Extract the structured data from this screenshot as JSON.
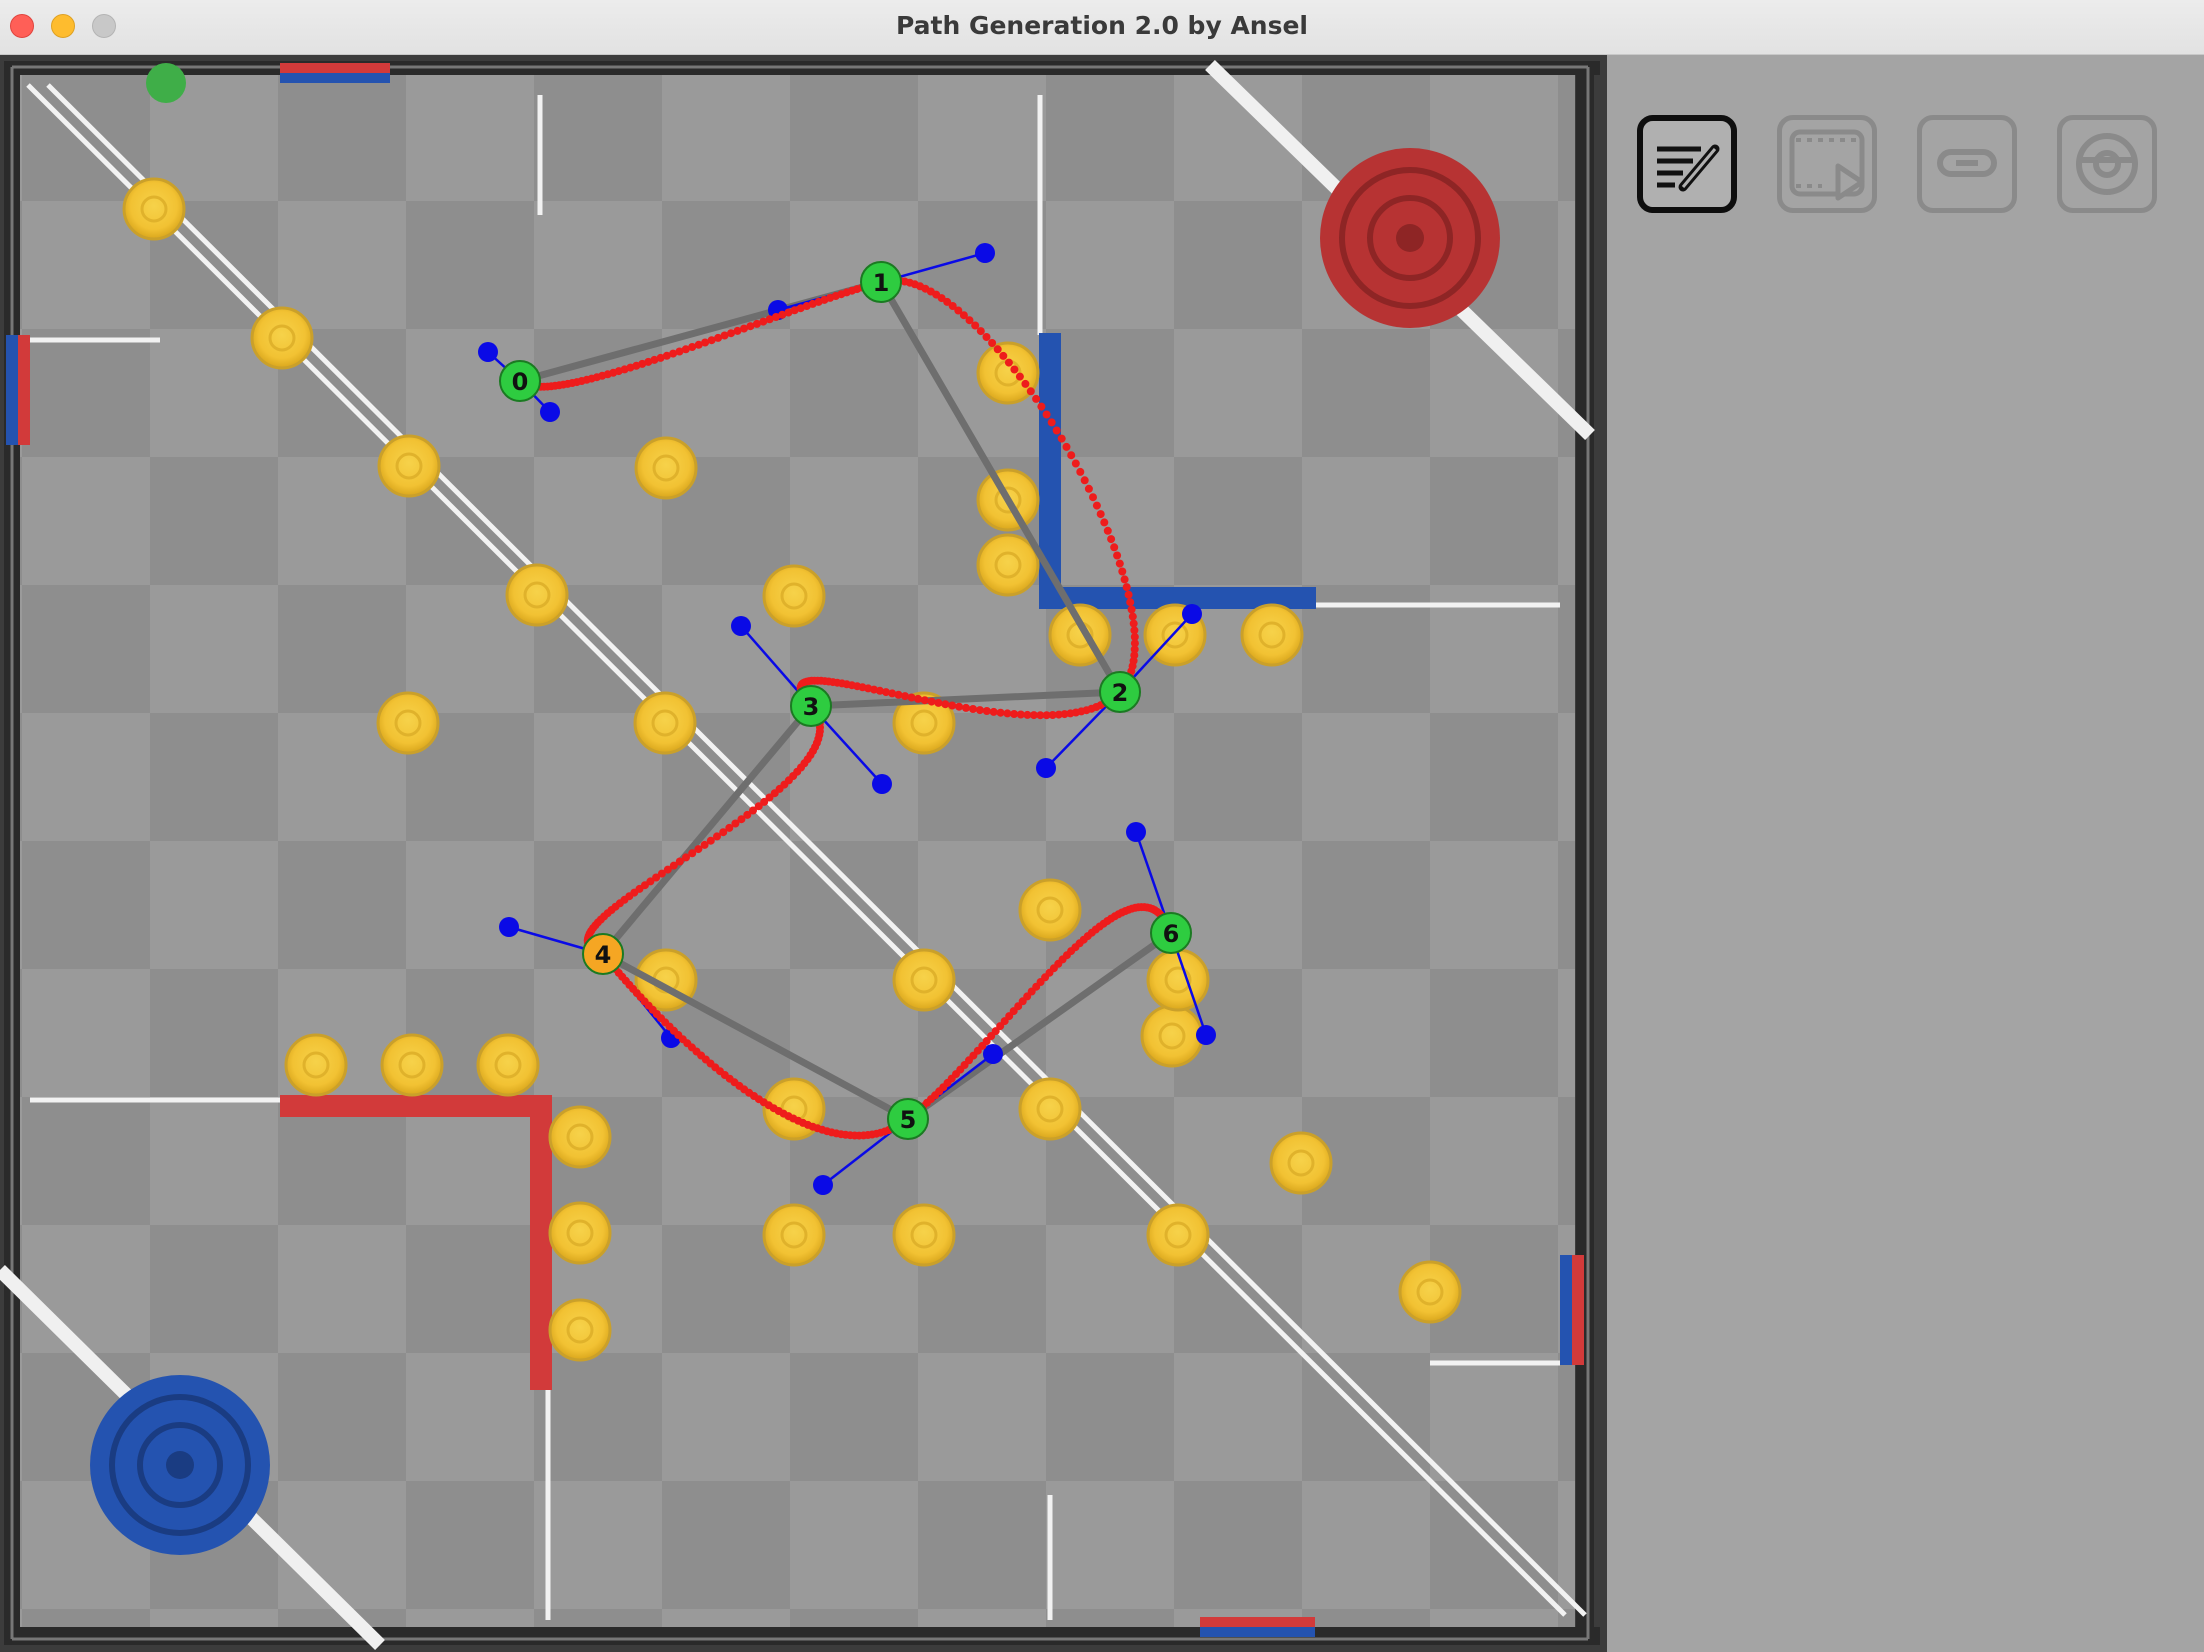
{
  "window": {
    "title": "Path Generation 2.0 by Ansel"
  },
  "toolbar": {
    "tools": [
      {
        "name": "edit-path-icon",
        "active": true
      },
      {
        "name": "play-animation-icon",
        "active": false
      },
      {
        "name": "link-icon",
        "active": false
      },
      {
        "name": "robot-view-icon",
        "active": false
      }
    ]
  },
  "path": {
    "nodes": [
      {
        "label": "0",
        "color": "#2ecc40"
      },
      {
        "label": "1",
        "color": "#2ecc40"
      },
      {
        "label": "2",
        "color": "#2ecc40"
      },
      {
        "label": "3",
        "color": "#2ecc40"
      },
      {
        "label": "4",
        "color": "#f5a623"
      },
      {
        "label": "5",
        "color": "#2ecc40"
      },
      {
        "label": "6",
        "color": "#2ecc40"
      }
    ],
    "path_color": "#ee1c1c",
    "handle_color": "#0a0ae6",
    "link_color": "#6e6e6e"
  },
  "field": {
    "red_alliance_color": "#d23a3a",
    "blue_alliance_color": "#2453b0",
    "ring_color": "#f2c233"
  }
}
